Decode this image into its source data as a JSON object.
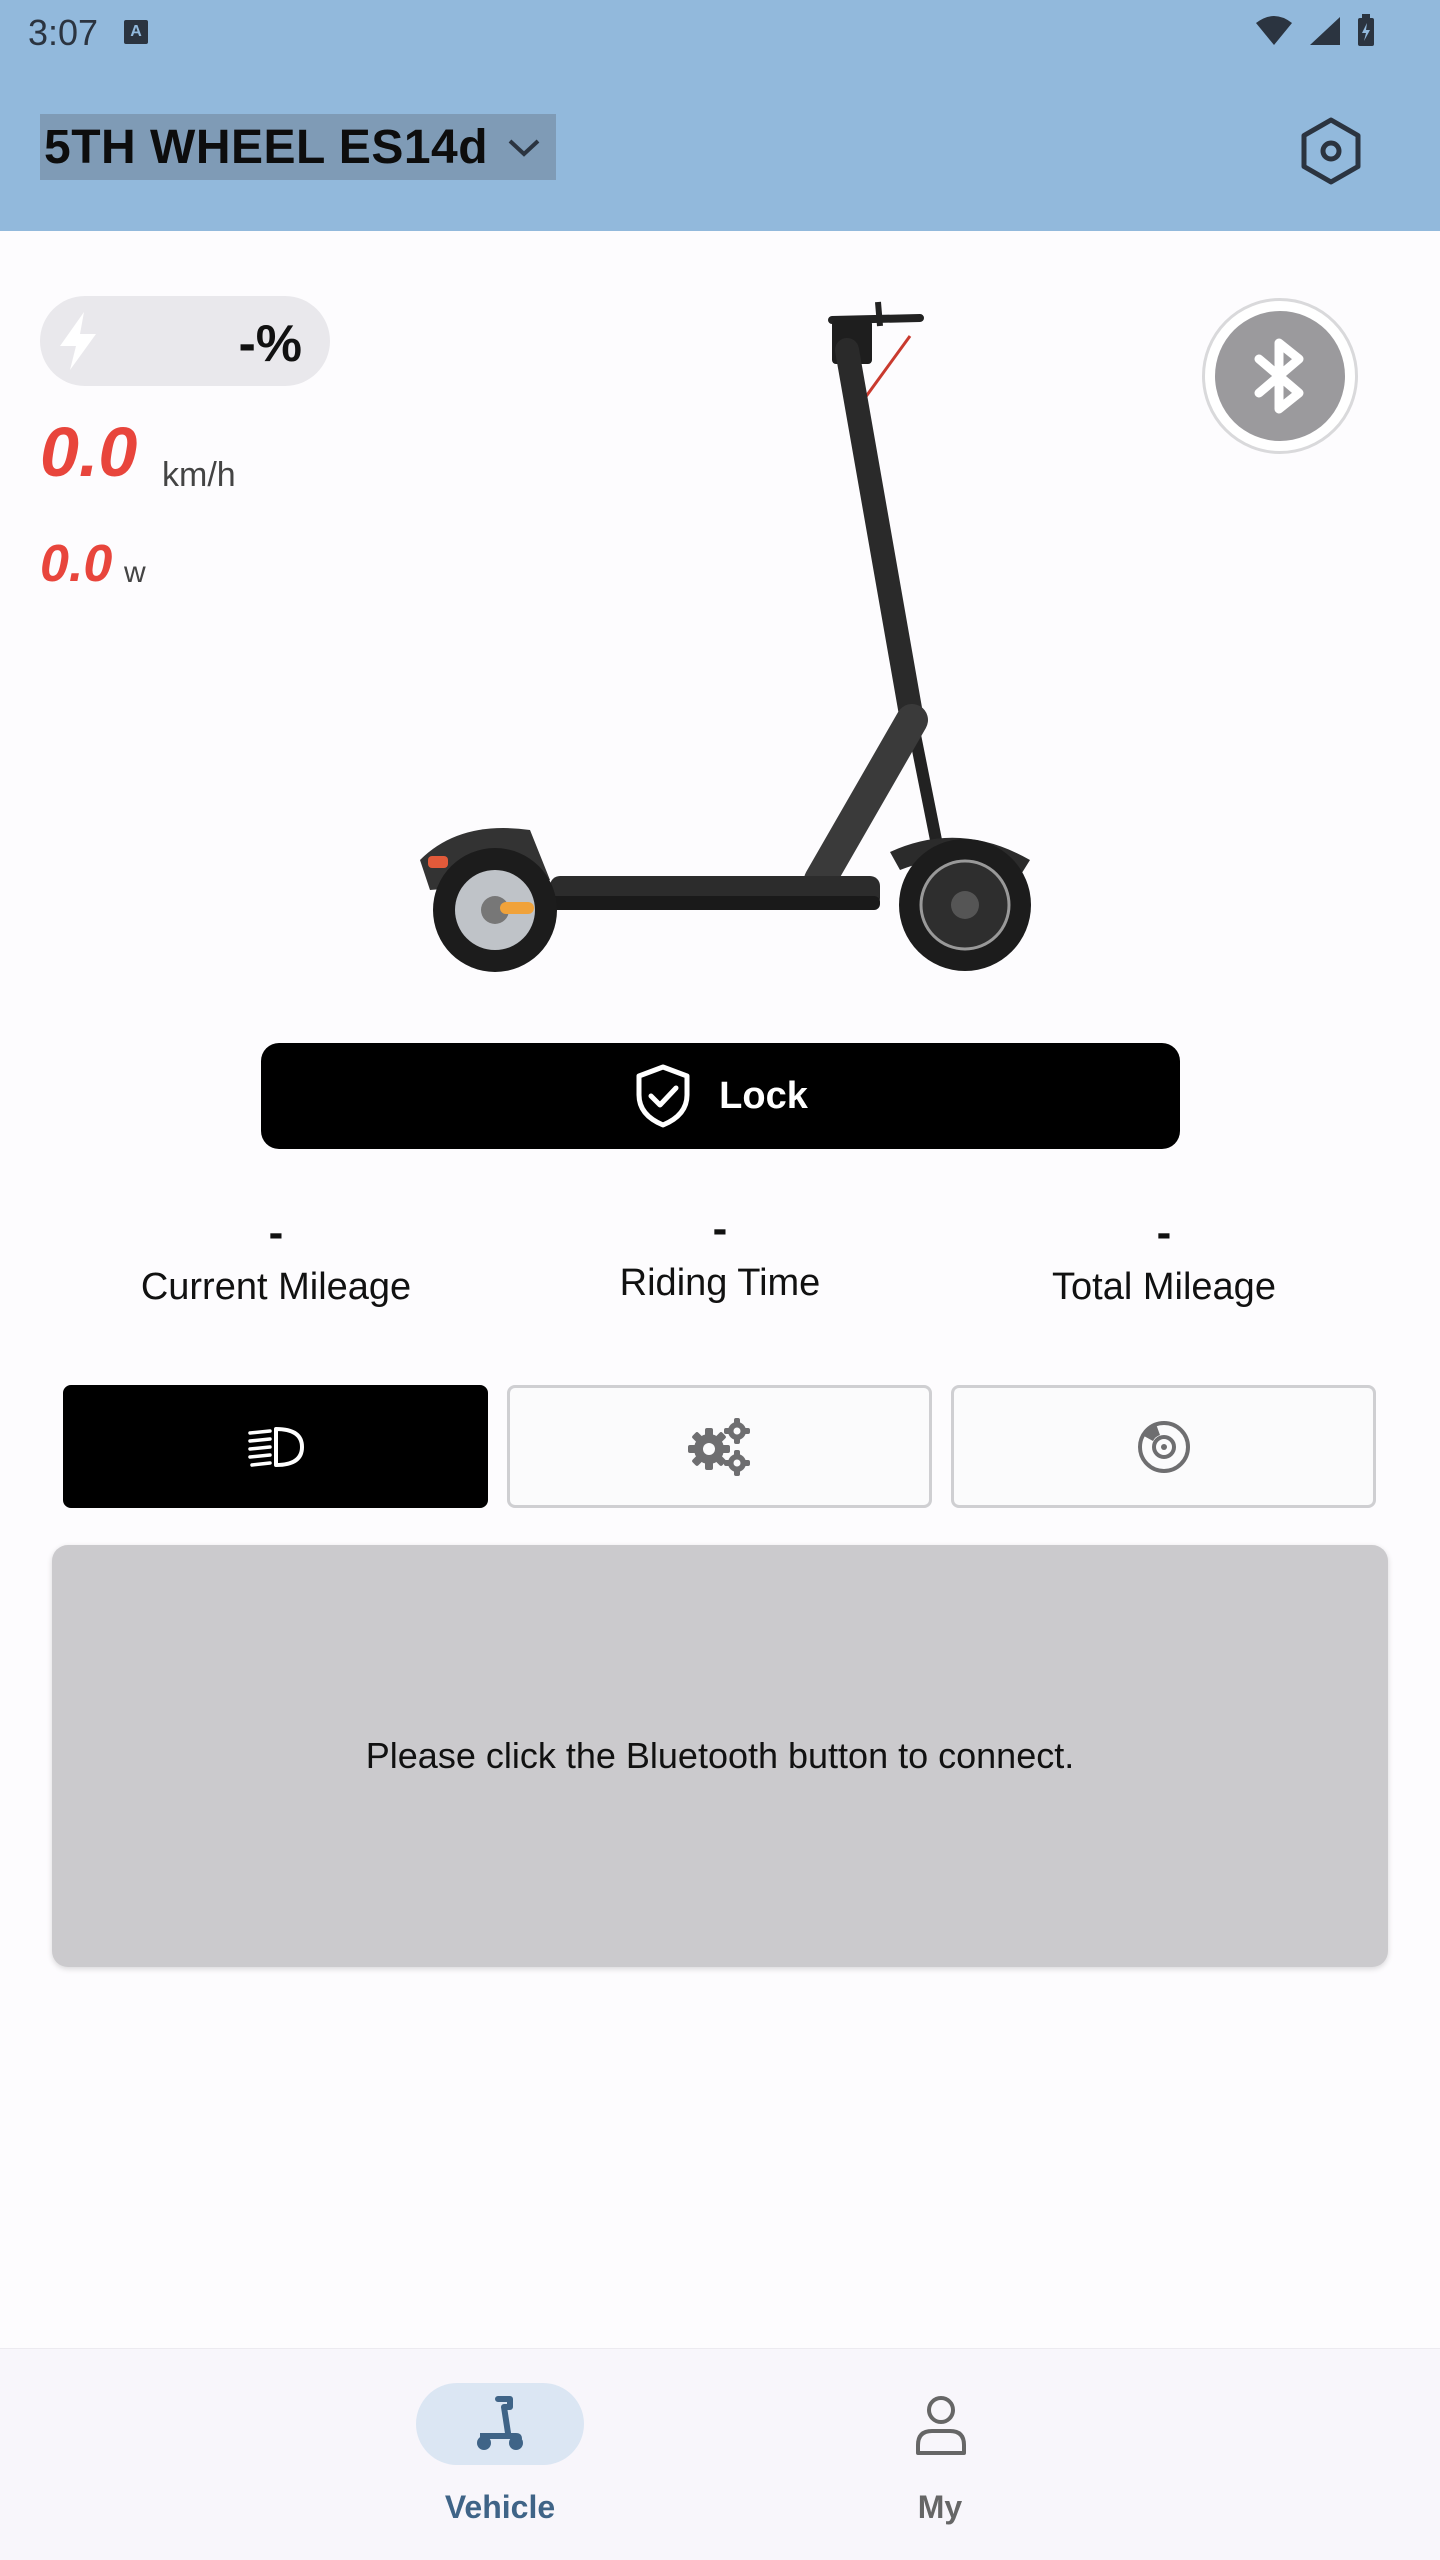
{
  "status_bar": {
    "time": "3:07",
    "notification_icon": "A"
  },
  "header": {
    "vehicle_name": "5TH WHEEL ES14d",
    "settings_icon": "hexagon-settings-icon"
  },
  "telemetry": {
    "battery": "-%",
    "speed": "0.0",
    "speed_unit": "km/h",
    "power": "0.0",
    "power_unit": "w"
  },
  "lock_button": {
    "label": "Lock"
  },
  "stats": [
    {
      "value": "-",
      "label": "Current Mileage"
    },
    {
      "value": "-",
      "label": "Riding Time"
    },
    {
      "value": "-",
      "label": "Total Mileage"
    }
  ],
  "modes": [
    {
      "name": "headlight",
      "icon": "headlight-icon",
      "active": true
    },
    {
      "name": "gears",
      "icon": "gears-icon",
      "active": false
    },
    {
      "name": "brake",
      "icon": "brake-disc-icon",
      "active": false
    }
  ],
  "info_panel": {
    "message": "Please click the Bluetooth button to connect."
  },
  "bottom_nav": [
    {
      "label": "Vehicle",
      "icon": "scooter-icon",
      "active": true
    },
    {
      "label": "My",
      "icon": "person-icon",
      "active": false
    }
  ],
  "colors": {
    "header": "#92b9dc",
    "accent_red": "#e8453c",
    "nav_active": "#3f6487"
  }
}
